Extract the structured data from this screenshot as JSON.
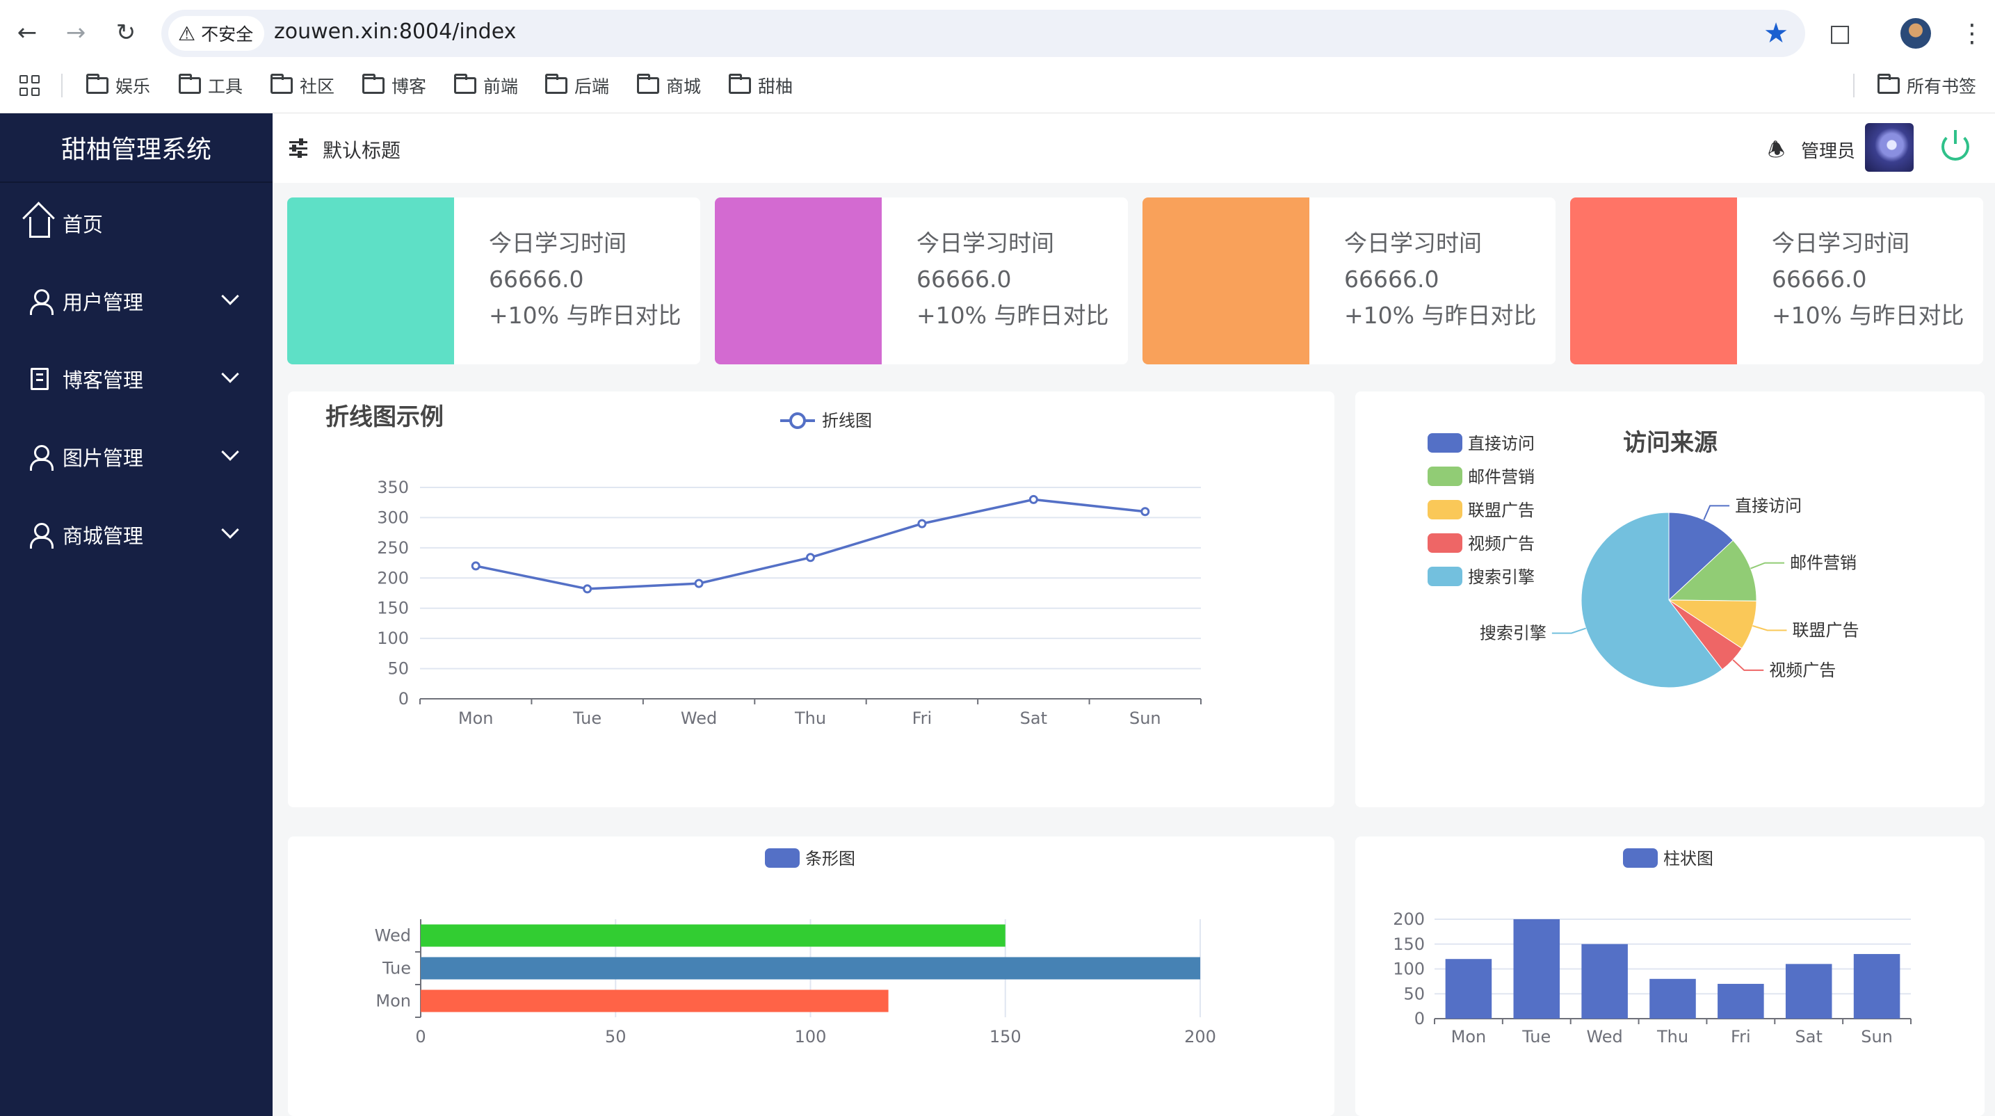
{
  "browser": {
    "insecure_label": "不安全",
    "url": "zouwen.xin:8004/index",
    "bookmarks": [
      "娱乐",
      "工具",
      "社区",
      "博客",
      "前端",
      "后端",
      "商城",
      "甜柚"
    ],
    "all_bookmarks_label": "所有书签"
  },
  "sidebar": {
    "title": "甜柚管理系统",
    "items": [
      {
        "label": "首页",
        "icon": "home-icon"
      },
      {
        "label": "用户管理",
        "icon": "user-icon"
      },
      {
        "label": "博客管理",
        "icon": "document-icon"
      },
      {
        "label": "图片管理",
        "icon": "user-icon"
      },
      {
        "label": "商城管理",
        "icon": "user-icon"
      }
    ]
  },
  "header": {
    "title": "默认标题",
    "admin_name": "管理员"
  },
  "stat_cards": [
    {
      "color": "#5ee0c6",
      "title": "今日学习时间",
      "value": "66666.0",
      "compare": "+10% 与昨日对比"
    },
    {
      "color": "#d36ad1",
      "title": "今日学习时间",
      "value": "66666.0",
      "compare": "+10% 与昨日对比"
    },
    {
      "color": "#f9a15a",
      "title": "今日学习时间",
      "value": "66666.0",
      "compare": "+10% 与昨日对比"
    },
    {
      "color": "#ff7466",
      "title": "今日学习时间",
      "value": "66666.0",
      "compare": "+10% 与昨日对比"
    }
  ],
  "chart_data": [
    {
      "type": "line",
      "title": "折线图示例",
      "legend": "折线图",
      "categories": [
        "Mon",
        "Tue",
        "Wed",
        "Thu",
        "Fri",
        "Sat",
        "Sun"
      ],
      "values": [
        220,
        182,
        191,
        234,
        290,
        330,
        310
      ],
      "yticks": [
        "0",
        "50",
        "100",
        "150",
        "200",
        "250",
        "300",
        "350"
      ],
      "ylim": [
        0,
        350
      ],
      "color": "#5470c6"
    },
    {
      "type": "pie",
      "title": "访问来源",
      "legend_position": "left",
      "slices": [
        {
          "name": "直接访问",
          "value": 335,
          "color": "#5470c6"
        },
        {
          "name": "邮件营销",
          "value": 310,
          "color": "#91cc75"
        },
        {
          "name": "联盟广告",
          "value": 234,
          "color": "#fac858"
        },
        {
          "name": "视频广告",
          "value": 135,
          "color": "#ee6666"
        },
        {
          "name": "搜索引擎",
          "value": 1548,
          "color": "#73c0de"
        }
      ]
    },
    {
      "type": "bar",
      "orientation": "horizontal",
      "legend": "条形图",
      "categories": [
        "Mon",
        "Tue",
        "Wed"
      ],
      "values": [
        120,
        200,
        150
      ],
      "colors": [
        "#ff6347",
        "#4682b4",
        "#32cd32"
      ],
      "xticks": [
        "0",
        "50",
        "100",
        "150",
        "200"
      ],
      "xlim": [
        0,
        200
      ]
    },
    {
      "type": "bar",
      "orientation": "vertical",
      "legend": "柱状图",
      "categories": [
        "Mon",
        "Tue",
        "Wed",
        "Thu",
        "Fri",
        "Sat",
        "Sun"
      ],
      "values": [
        120,
        200,
        150,
        80,
        70,
        110,
        130
      ],
      "yticks": [
        "0",
        "50",
        "100",
        "150",
        "200"
      ],
      "ylim": [
        0,
        200
      ],
      "color": "#5470c6"
    }
  ]
}
